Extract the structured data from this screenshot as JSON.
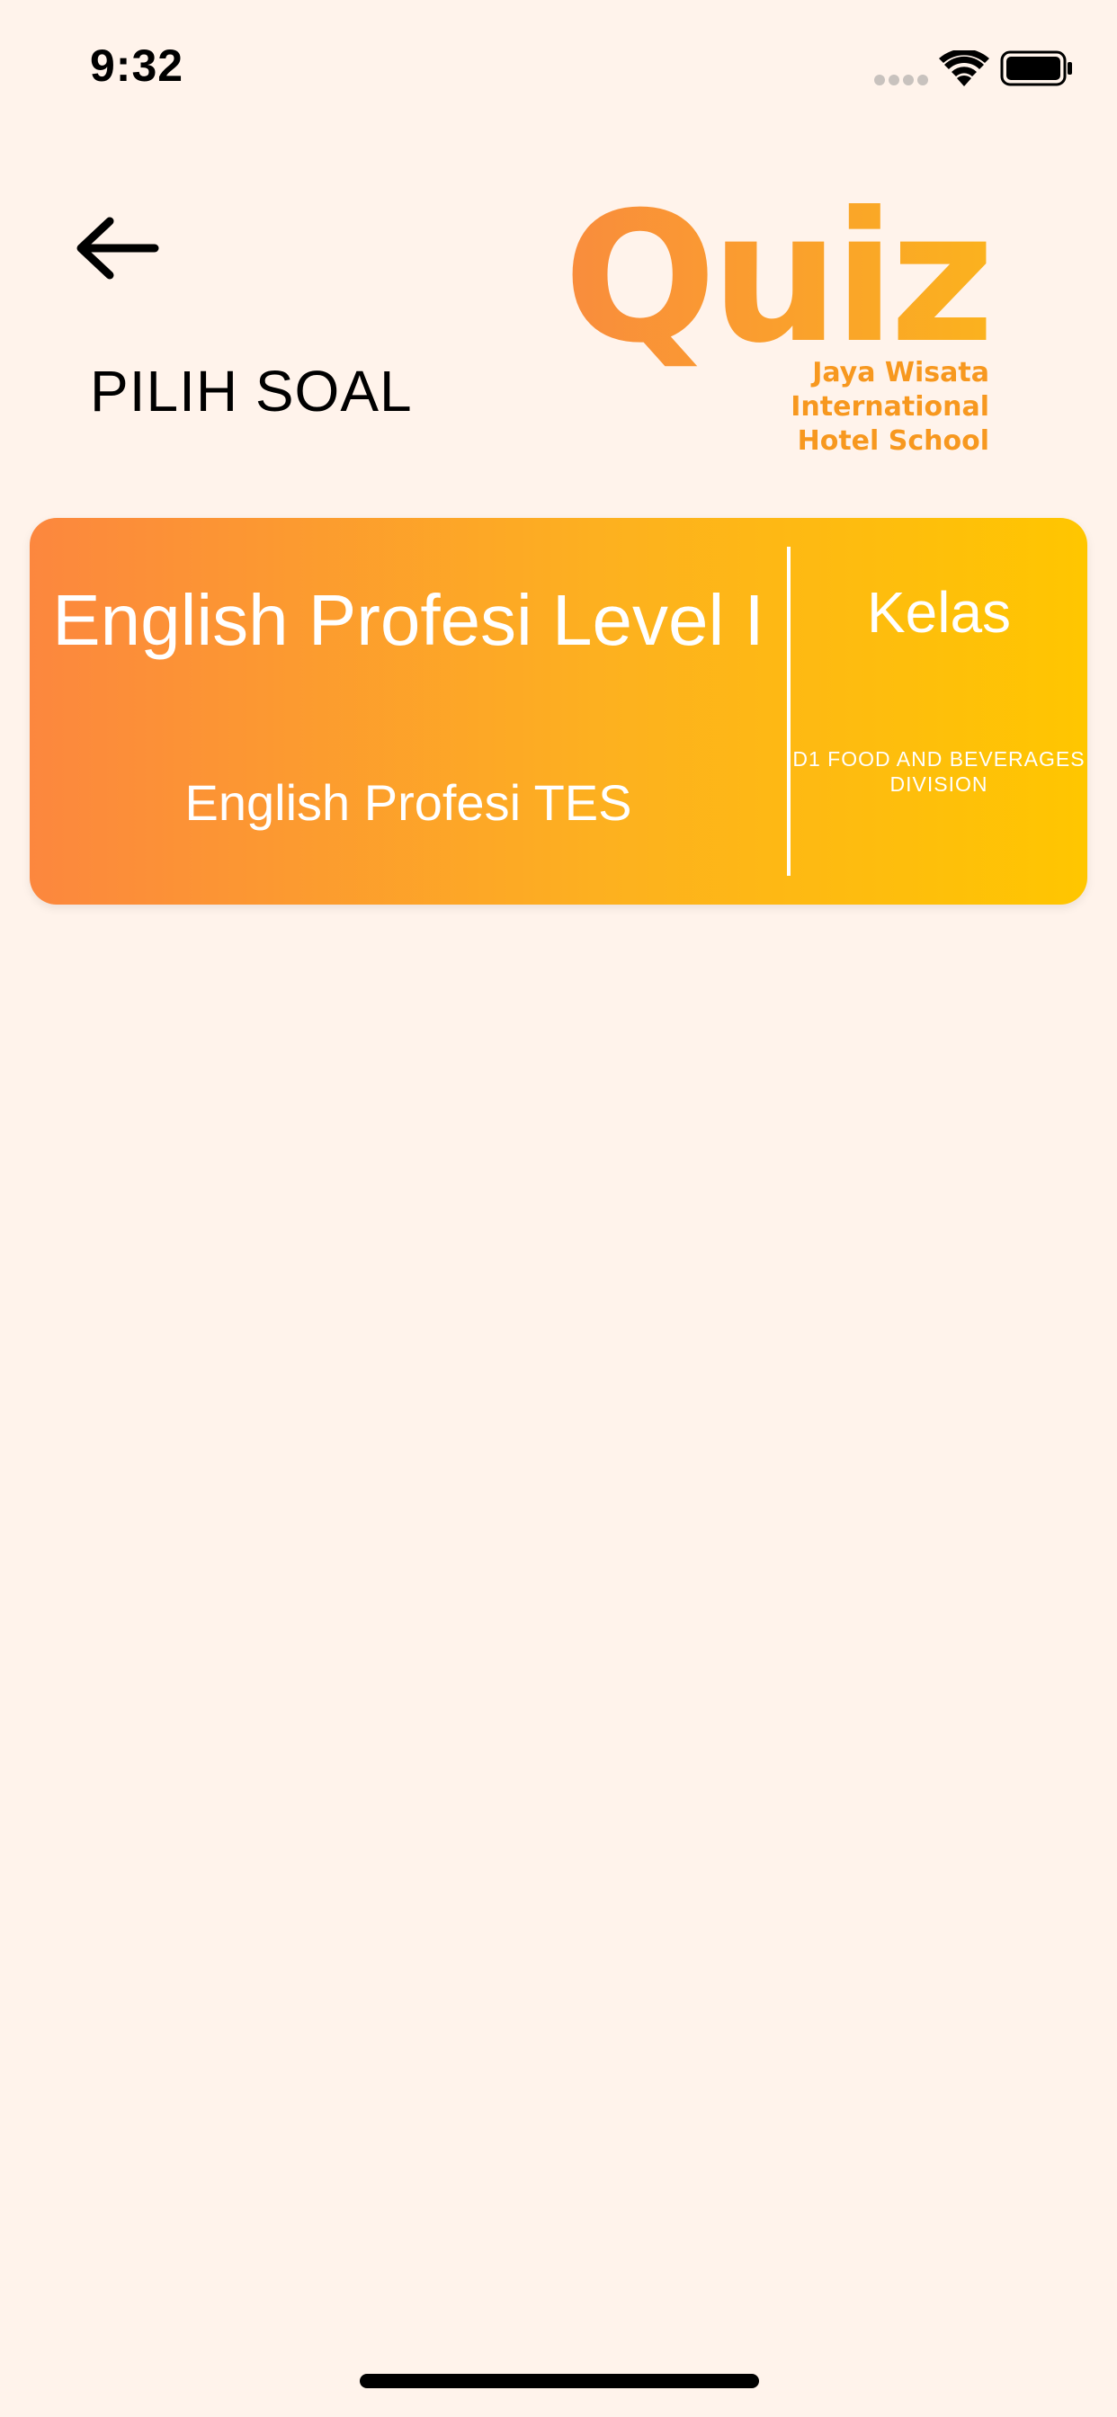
{
  "status_bar": {
    "time": "9:32"
  },
  "header": {
    "title": "PILIH SOAL",
    "back_icon": "arrow-left-icon"
  },
  "logo": {
    "word": "Quiz",
    "subtitle_line1": "Jaya Wisata International",
    "subtitle_line2": "Hotel School"
  },
  "quiz_card": {
    "title": "English Profesi Level I",
    "subtitle": "English Profesi TES",
    "class_label": "Kelas",
    "class_value": "D1 FOOD AND BEVERAGES DIVISION"
  },
  "colors": {
    "background": "#fff3eb",
    "card_gradient_start": "#fc873e",
    "card_gradient_end": "#ffc600",
    "logo_orange": "#f7981f"
  }
}
